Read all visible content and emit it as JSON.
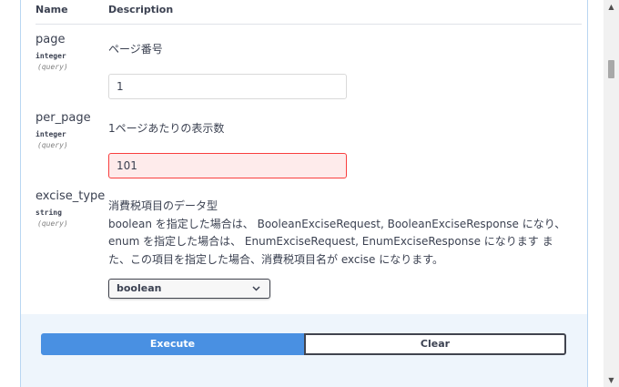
{
  "table": {
    "header_name": "Name",
    "header_description": "Description"
  },
  "params": [
    {
      "name": "page",
      "type": "integer",
      "in": "(query)",
      "description": "ページ番号",
      "value": "1",
      "invalid": false
    },
    {
      "name": "per_page",
      "type": "integer",
      "in": "(query)",
      "description": "1ページあたりの表示数",
      "value": "101",
      "invalid": true
    },
    {
      "name": "excise_type",
      "type": "string",
      "in": "(query)",
      "description_lines": [
        "消費税項目のデータ型",
        "boolean を指定した場合は、 BooleanExciseRequest, BooleanExciseResponse になり、",
        "enum を指定した場合は、 EnumExciseRequest, EnumExciseResponse になります ま",
        "た、この項目を指定した場合、消費税項目名が excise になります。"
      ],
      "selected": "boolean",
      "chevron": "⌄"
    }
  ],
  "actions": {
    "execute_label": "Execute",
    "clear_label": "Clear"
  },
  "colors": {
    "execute_bg": "#4990e2",
    "invalid_border": "#f93e3e",
    "invalid_bg": "#feebeb"
  },
  "icons": {
    "scroll_up": "▲",
    "scroll_down": "▼",
    "dropdown": "chevron-down-icon"
  }
}
